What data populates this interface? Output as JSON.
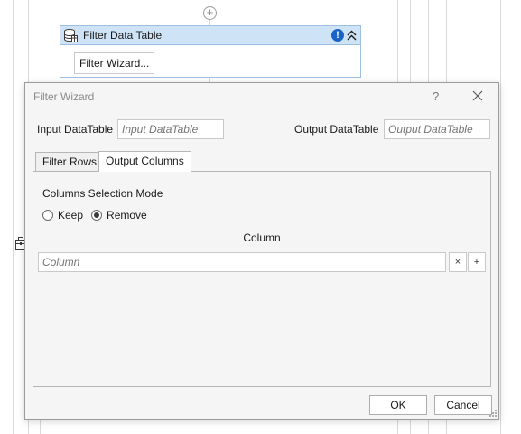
{
  "designer": {
    "add_icon": "plus-circle-icon",
    "side_icon": "toolbox-icon"
  },
  "activity": {
    "title": "Filter Data Table",
    "wizard_button": "Filter Wizard...",
    "icon": "database-table-icon",
    "warning_icon": "exclamation-icon",
    "collapse_icon": "double-chevron-up-icon",
    "header_color": "#cfe3f7",
    "warning_color": "#1a64c8"
  },
  "dialog": {
    "title": "Filter Wizard",
    "help": "?",
    "close_icon": "close-icon",
    "input_label": "Input DataTable",
    "input_placeholder": "Input DataTable",
    "output_label": "Output DataTable",
    "output_placeholder": "Output DataTable",
    "tabs": [
      {
        "label": "Filter Rows",
        "active": false
      },
      {
        "label": "Output Columns",
        "active": true
      }
    ],
    "columns_selection_mode_label": "Columns Selection Mode",
    "modes": [
      {
        "label": "Keep",
        "checked": false
      },
      {
        "label": "Remove",
        "checked": true
      }
    ],
    "column_header": "Column",
    "column_placeholder": "Column",
    "remove_button": "×",
    "add_button": "+",
    "ok_label": "OK",
    "cancel_label": "Cancel"
  }
}
